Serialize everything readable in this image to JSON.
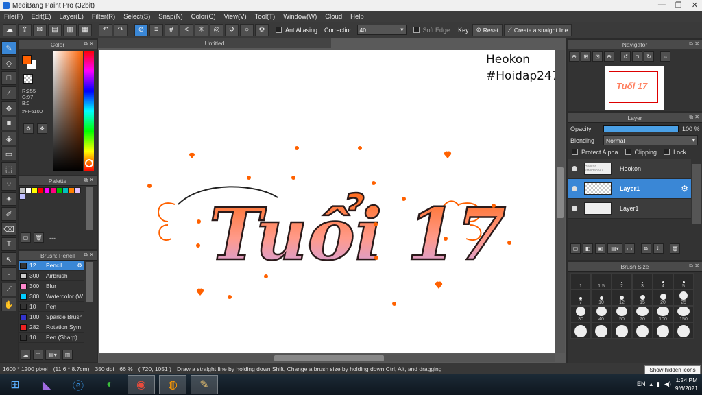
{
  "app": {
    "title": "MediBang Paint Pro (32bit)"
  },
  "menu": [
    "File(F)",
    "Edit(E)",
    "Layer(L)",
    "Filter(R)",
    "Select(S)",
    "Snap(N)",
    "Color(C)",
    "View(V)",
    "Tool(T)",
    "Window(W)",
    "Cloud",
    "Help"
  ],
  "toolbar": {
    "antialias_label": "AntiAliasing",
    "correction_label": "Correction",
    "correction_value": "40",
    "soft_edge_label": "Soft Edge",
    "key_label": "Key",
    "reset_label": "Reset",
    "straight_label": "Create a straight line"
  },
  "color_panel": {
    "title": "Color",
    "r": "R:255",
    "g": "G:97",
    "b": "B:0",
    "hex": "#FF6100",
    "fg": "#FF6100"
  },
  "palette_panel": {
    "title": "Palette",
    "swatches": [
      "#c0c0c0",
      "#ffffff",
      "#ffff00",
      "#ff0000",
      "#ff00ff",
      "#ff0080",
      "#00c000",
      "#00c0c0",
      "#ff8000",
      "#e0c0ff",
      "#c0c0ff"
    ],
    "footer": "---"
  },
  "brush_panel": {
    "title": "Brush: Pencil",
    "items": [
      {
        "size": "12",
        "name": "Pencil",
        "color": "#333333"
      },
      {
        "size": "300",
        "name": "Airbrush",
        "color": "#cccccc"
      },
      {
        "size": "300",
        "name": "Blur",
        "color": "#ff88cc"
      },
      {
        "size": "300",
        "name": "Watercolor (W",
        "color": "#00ccff"
      },
      {
        "size": "10",
        "name": "Pen",
        "color": "#333333"
      },
      {
        "size": "100",
        "name": "Sparkle Brush",
        "color": "#3333cc"
      },
      {
        "size": "282",
        "name": "Rotation Sym",
        "color": "#ee2222"
      },
      {
        "size": "10",
        "name": "Pen (Sharp)",
        "color": "#333333"
      }
    ]
  },
  "document": {
    "tab": "Untitled",
    "watermark_line1": "Heokon",
    "watermark_line2": "#Hoidap247",
    "art_text": "Tuổi 17"
  },
  "navigator": {
    "title": "Navigator"
  },
  "layer_panel": {
    "title": "Layer",
    "opacity_label": "Opacity",
    "opacity_value": "100 %",
    "opacity_fraction": 1.0,
    "blending_label": "Blending",
    "blending_value": "Normal",
    "protect_alpha": "Protect Alpha",
    "clipping": "Clipping",
    "lock": "Lock",
    "layers": [
      {
        "name": "Heokon",
        "thumb": "Heokon #Hoidap247"
      },
      {
        "name": "Layer1",
        "thumb": ""
      },
      {
        "name": "Layer1",
        "thumb": ""
      }
    ]
  },
  "brush_size_panel": {
    "title": "Brush Size",
    "sizes": [
      "1",
      "1.5",
      "2",
      "3",
      "4",
      "5",
      "7",
      "10",
      "12",
      "15",
      "20",
      "25",
      "30",
      "40",
      "50",
      "70",
      "100",
      "150",
      "",
      "",
      "",
      "",
      "",
      ""
    ]
  },
  "status": {
    "dims": "1600 * 1200 pixel",
    "cm": "(11.6 * 8.7cm)",
    "dpi": "350 dpi",
    "zoom": "66 %",
    "coords": "( 720, 1051 )",
    "hint": "Draw a straight line by holding down Shift, Change a brush size by holding down Ctrl, Alt, and dragging"
  },
  "tooltip": "Show hidden icons",
  "taskbar": {
    "lang": "EN",
    "time": "1:24 PM",
    "date": "9/6/2021"
  }
}
